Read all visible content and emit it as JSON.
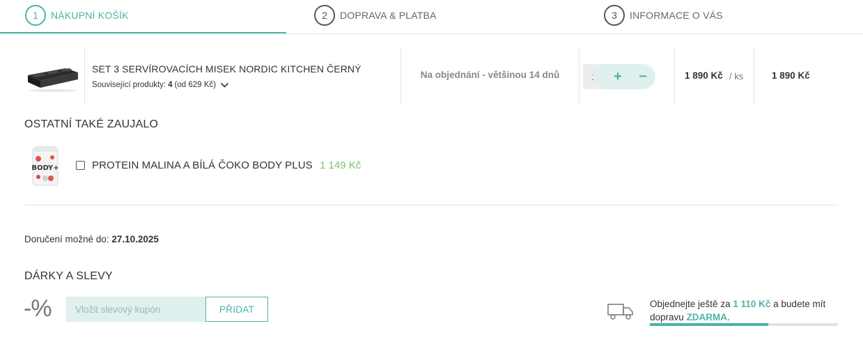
{
  "steps": [
    {
      "num": "1",
      "label": "NÁKUPNÍ KOŠÍK"
    },
    {
      "num": "2",
      "label": "DOPRAVA & PLATBA"
    },
    {
      "num": "3",
      "label": "INFORMACE O VÁS"
    }
  ],
  "colors": {
    "accent": "#4ab3a8",
    "accent_light": "#dff0ee",
    "price_green": "#7cc36e"
  },
  "cart_item": {
    "name": "SET 3 SERVÍROVACÍCH MISEK NORDIC KITCHEN ČERNÝ",
    "related_label": "Související produkty:",
    "related_count": "4",
    "related_from": "(od 629 Kč)",
    "availability": "Na objednání - většinou 14 dnů",
    "quantity": "1",
    "plus": "+",
    "minus": "−",
    "unit_price": "1 890 Kč",
    "unit": "/ ks",
    "total": "1 890 Kč",
    "icons": {
      "expand": "chevron-down-icon"
    }
  },
  "others": {
    "title": "OSTATNÍ TAKÉ ZAUJALO",
    "items": [
      {
        "name": "PROTEIN MALINA A BÍLÁ ČOKO BODY PLUS",
        "price": "1 149 Kč",
        "image_text": "BODY+"
      }
    ]
  },
  "delivery": {
    "label": "Doručení možné do:",
    "date": "27.10.2025"
  },
  "gifts": {
    "title": "DÁRKY A SLEVY",
    "icon_text": "-%",
    "coupon_placeholder": "Vložit slevový kupón",
    "add_label": "PŘIDAT"
  },
  "free_shipping": {
    "text_before": "Objednejte ještě za",
    "amount": "1 110 Kč",
    "text_middle": "a budete mít dopravu",
    "highlight": "ZDARMA",
    "text_end": ".",
    "progress": 0.63,
    "icon": "truck-icon"
  }
}
